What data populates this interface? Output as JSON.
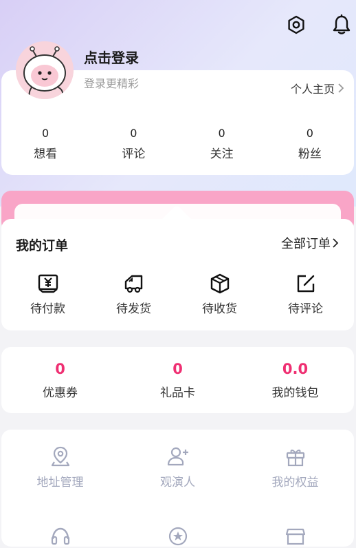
{
  "header": {
    "settings_icon": "settings-icon",
    "bell_icon": "bell-icon"
  },
  "profile": {
    "title": "点击登录",
    "subtitle": "登录更精彩",
    "home_link": "个人主页",
    "stats": [
      {
        "value": "0",
        "label": "想看"
      },
      {
        "value": "0",
        "label": "评论"
      },
      {
        "value": "0",
        "label": "关注"
      },
      {
        "value": "0",
        "label": "粉丝"
      }
    ]
  },
  "orders": {
    "title": "我的订单",
    "all_link": "全部订单",
    "items": [
      {
        "label": "待付款",
        "icon": "payment-icon"
      },
      {
        "label": "待发货",
        "icon": "truck-icon"
      },
      {
        "label": "待收货",
        "icon": "package-icon"
      },
      {
        "label": "待评论",
        "icon": "edit-icon"
      }
    ]
  },
  "wallet": {
    "items": [
      {
        "value": "0",
        "label": "优惠券"
      },
      {
        "value": "0",
        "label": "礼品卡"
      },
      {
        "value": "0.0",
        "label": "我的钱包"
      }
    ]
  },
  "services": {
    "items": [
      {
        "label": "地址管理",
        "icon": "location-icon"
      },
      {
        "label": "观演人",
        "icon": "add-person-icon"
      },
      {
        "label": "我的权益",
        "icon": "gift-icon"
      }
    ],
    "partial_icons": [
      "headset-icon",
      "star-badge-icon",
      "store-icon"
    ]
  },
  "colors": {
    "accent_pink": "#ef2f72",
    "band_pink": "#f9a5c7",
    "muted_text": "#a3a8bd"
  }
}
